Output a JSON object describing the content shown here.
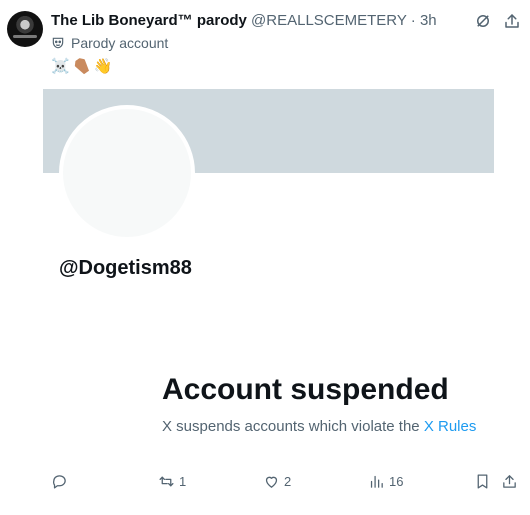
{
  "post": {
    "display_name": "The Lib Boneyard™ parody",
    "handle": "@REALLSCEMETERY",
    "separator": "·",
    "time": "3h",
    "parody_label": "Parody account",
    "emojis": [
      "☠️",
      "coffin",
      "👋"
    ]
  },
  "card": {
    "handle": "@Dogetism88",
    "suspend_title": "Account suspended",
    "suspend_desc": "X suspends accounts which violate the ",
    "rules_link": "X Rules"
  },
  "actions": {
    "reply_count": "",
    "repost_count": "1",
    "like_count": "2",
    "views_count": "16"
  },
  "colors": {
    "text_primary": "#0f1419",
    "text_secondary": "#536471",
    "link": "#1d9bf0",
    "banner": "#cfd9de"
  },
  "icons": {
    "top_right": [
      "grok-icon",
      "more-icon"
    ],
    "parody": "mask-icon",
    "actions": [
      "reply-icon",
      "repost-icon",
      "like-icon",
      "views-icon",
      "bookmark-icon",
      "share-icon"
    ]
  }
}
